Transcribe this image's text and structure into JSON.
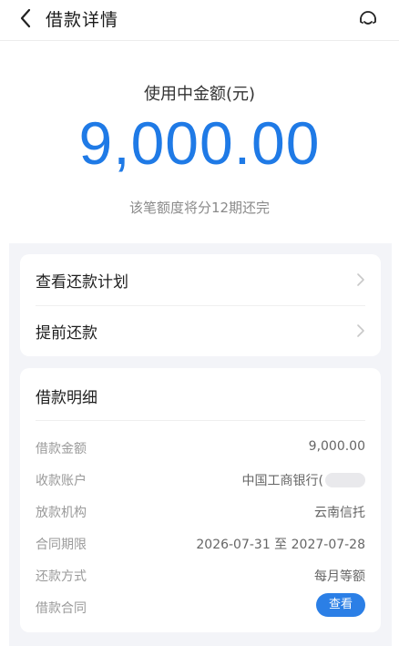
{
  "header": {
    "title": "借款详情",
    "back_icon": "chevron-left-icon",
    "service_icon": "customer-service-icon"
  },
  "hero": {
    "label": "使用中金额(元)",
    "amount": "9,000.00",
    "subtitle": "该笔额度将分12期还完",
    "accent_color": "#1f7ae6"
  },
  "menu": {
    "items": [
      {
        "label": "查看还款计划"
      },
      {
        "label": "提前还款"
      }
    ]
  },
  "detail": {
    "title": "借款明细",
    "rows": [
      {
        "key": "借款金额",
        "value": "9,000.00"
      },
      {
        "key": "收款账户",
        "value": "中国工商银行("
      },
      {
        "key": "放款机构",
        "value": "云南信托"
      },
      {
        "key": "合同期限",
        "value": "2026-07-31 至 2027-07-28"
      },
      {
        "key": "还款方式",
        "value": "每月等额"
      },
      {
        "key": "借款合同",
        "button": "查看"
      }
    ]
  }
}
